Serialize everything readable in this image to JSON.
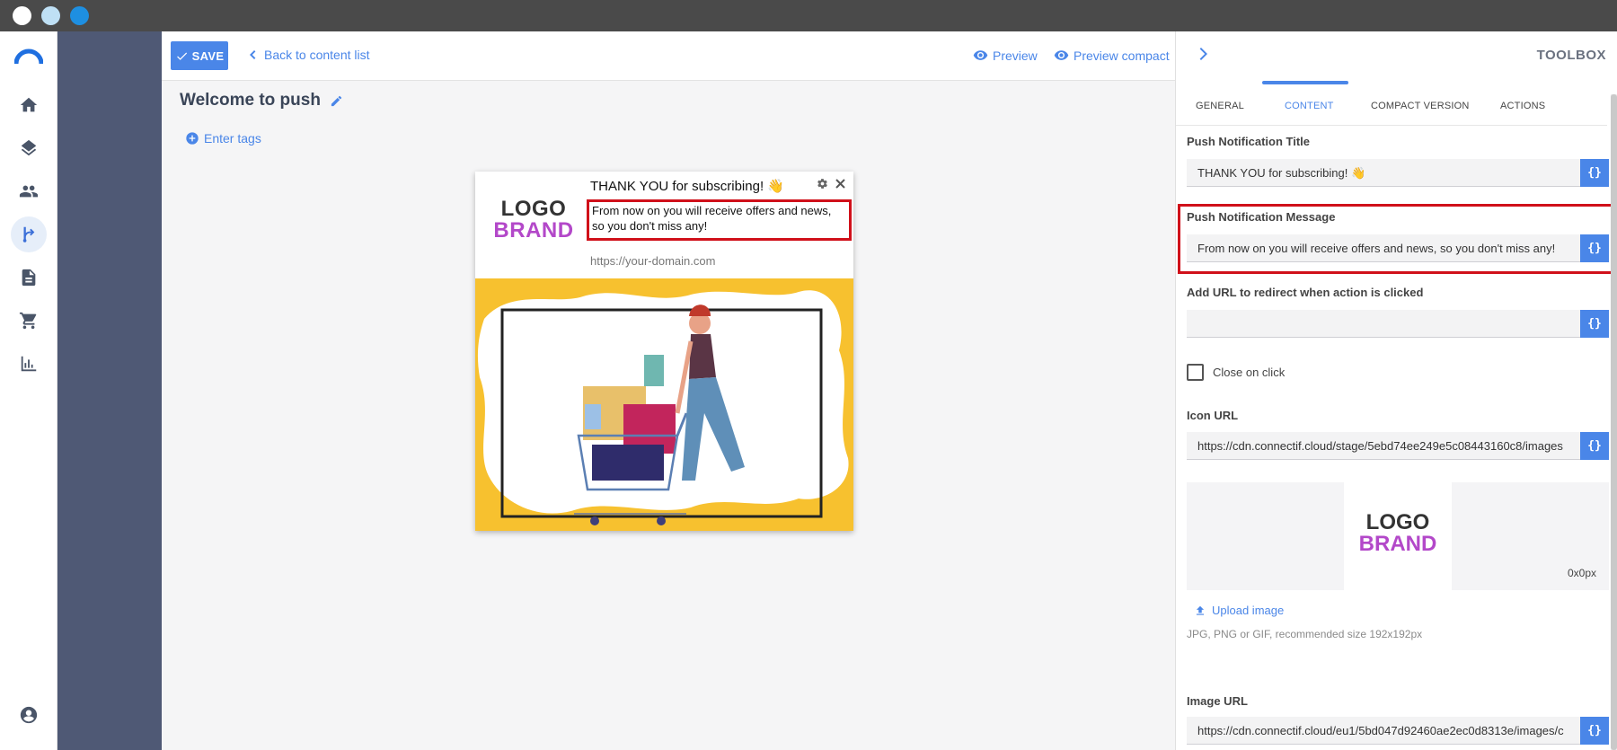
{
  "window": {
    "dot_colors": [
      "#ffffff",
      "#bfe0f5",
      "#1e8fe1"
    ]
  },
  "nav": {
    "items": [
      {
        "icon": "home-icon",
        "active": false
      },
      {
        "icon": "layers-icon",
        "active": false
      },
      {
        "icon": "people-icon",
        "active": false
      },
      {
        "icon": "workflow-icon",
        "active": true
      },
      {
        "icon": "document-icon",
        "active": false
      },
      {
        "icon": "cart-icon",
        "active": false
      },
      {
        "icon": "bar-chart-icon",
        "active": false
      },
      {
        "icon": "account-icon",
        "active": false
      }
    ]
  },
  "toolbar": {
    "save_label": "SAVE",
    "back_label": "Back to content list",
    "preview_label": "Preview",
    "preview_compact_label": "Preview compact"
  },
  "page": {
    "title": "Welcome to push",
    "tags_label": "Enter tags"
  },
  "notification": {
    "logo_line1": "LOGO",
    "logo_line2": "BRAND",
    "title": "THANK YOU for subscribing! 👋",
    "message": "From now on you will receive offers and news, so you don't miss any!",
    "domain": "https://your-domain.com"
  },
  "toolbox": {
    "title": "TOOLBOX",
    "tabs": [
      {
        "label": "GENERAL",
        "active": false
      },
      {
        "label": "CONTENT",
        "active": true
      },
      {
        "label": "COMPACT VERSION",
        "active": false
      },
      {
        "label": "ACTIONS",
        "active": false
      }
    ],
    "title_field": {
      "label": "Push Notification Title",
      "value": "THANK YOU for subscribing! 👋"
    },
    "message_field": {
      "label": "Push Notification Message",
      "value": "From now on you will receive offers and news, so you don't miss any!"
    },
    "url_field": {
      "label": "Add URL to redirect when action is clicked",
      "value": ""
    },
    "close_on_click": {
      "label": "Close on click",
      "checked": false
    },
    "icon_url_field": {
      "label": "Icon URL",
      "value": "https://cdn.connectif.cloud/stage/5ebd74ee249e5c08443160c8/images"
    },
    "icon_preview": {
      "logo_line1": "LOGO",
      "logo_line2": "BRAND",
      "dimensions": "0x0px"
    },
    "upload_label": "Upload image",
    "upload_hint": "JPG, PNG or GIF, recommended size 192x192px",
    "image_url_field": {
      "label": "Image URL",
      "value": "https://cdn.connectif.cloud/eu1/5bd047d92460ae2ec0d8313e/images/c"
    },
    "var_button_label": "{}"
  },
  "colors": {
    "accent": "#4a86e8",
    "brand_purple": "#b348c9",
    "highlight_red": "#d0101a",
    "rail": "#4f5975",
    "image_bg": "#f7c12f"
  }
}
